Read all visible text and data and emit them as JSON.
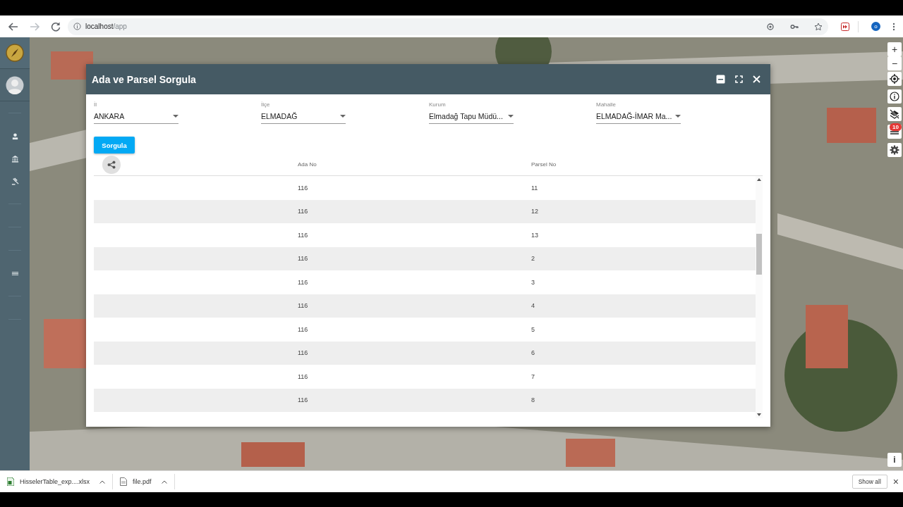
{
  "browser": {
    "url_host": "localhost",
    "url_path": "/app",
    "profile": "o"
  },
  "dialog": {
    "title": "Ada ve Parsel Sorgula",
    "filters": [
      {
        "label": "İl",
        "value": "ANKARA"
      },
      {
        "label": "İlçe",
        "value": "ELMADAĞ"
      },
      {
        "label": "Kurum",
        "value": "Elmadağ Tapu Müdü..."
      },
      {
        "label": "Mahalle",
        "value": "ELMADAĞ-İMAR Ma..."
      }
    ],
    "query_button": "Sorgula",
    "table": {
      "columns": [
        "Ada No",
        "Parsel No"
      ],
      "rows": [
        {
          "ada": "116",
          "parsel": "11"
        },
        {
          "ada": "116",
          "parsel": "12"
        },
        {
          "ada": "116",
          "parsel": "13"
        },
        {
          "ada": "116",
          "parsel": "2"
        },
        {
          "ada": "116",
          "parsel": "3"
        },
        {
          "ada": "116",
          "parsel": "4"
        },
        {
          "ada": "116",
          "parsel": "5"
        },
        {
          "ada": "116",
          "parsel": "6"
        },
        {
          "ada": "116",
          "parsel": "7"
        },
        {
          "ada": "116",
          "parsel": "8"
        }
      ]
    }
  },
  "map_controls": {
    "zoom_in": "+",
    "zoom_out": "−",
    "layers_badge": "10",
    "info_button": "i"
  },
  "downloads": {
    "items": [
      {
        "name": "HisselerTable_exp....xlsx",
        "kind": "excel"
      },
      {
        "name": "file.pdf",
        "kind": "pdf"
      }
    ],
    "show_all": "Show all",
    "close": "×"
  }
}
